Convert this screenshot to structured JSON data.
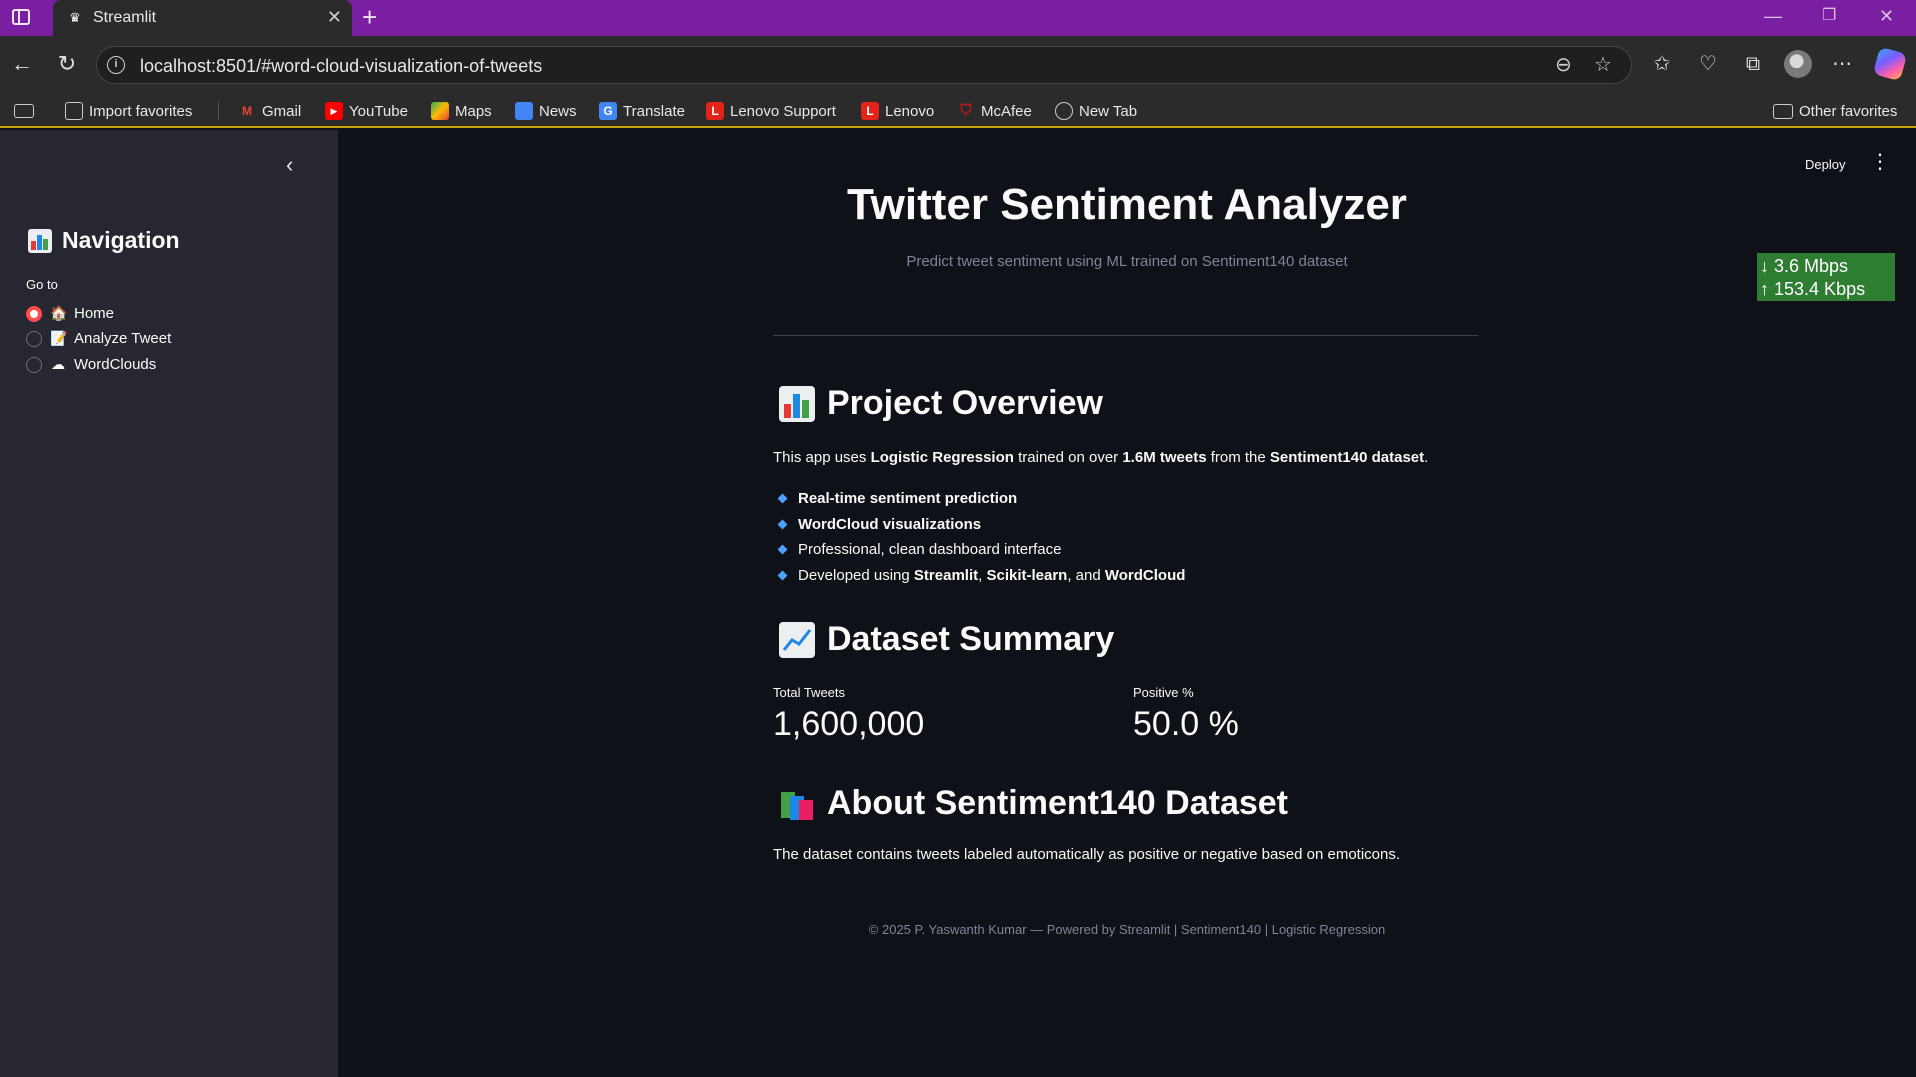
{
  "browser": {
    "tab_title": "Streamlit",
    "url": "localhost:8501/#word-cloud-visualization-of-tweets",
    "bookmarks": [
      {
        "label": "Import favorites",
        "icon": "import-icon"
      },
      {
        "label": "Gmail",
        "icon": "gmail-icon",
        "color": "#ea4335"
      },
      {
        "label": "YouTube",
        "icon": "youtube-icon",
        "color": "#ff0000"
      },
      {
        "label": "Maps",
        "icon": "maps-icon",
        "color": "#34a853"
      },
      {
        "label": "News",
        "icon": "news-icon",
        "color": "#4285f4"
      },
      {
        "label": "Translate",
        "icon": "translate-icon",
        "color": "#4285f4"
      },
      {
        "label": "Lenovo Support",
        "icon": "lenovo-icon",
        "color": "#e2231a"
      },
      {
        "label": "Lenovo",
        "icon": "lenovo-icon",
        "color": "#e2231a"
      },
      {
        "label": "McAfee",
        "icon": "mcafee-icon",
        "color": "#c01818"
      },
      {
        "label": "New Tab",
        "icon": "globe-icon"
      }
    ],
    "other_favorites": "Other favorites"
  },
  "sidebar": {
    "title": "Navigation",
    "goto_label": "Go to",
    "options": [
      {
        "label": "Home",
        "icon": "house-icon",
        "selected": true
      },
      {
        "label": "Analyze Tweet",
        "icon": "memo-icon",
        "selected": false
      },
      {
        "label": "WordClouds",
        "icon": "cloud-icon",
        "selected": false
      }
    ]
  },
  "header": {
    "deploy_label": "Deploy"
  },
  "netspeed": {
    "down": "3.6 Mbps",
    "up": "153.4 Kbps"
  },
  "main": {
    "title": "Twitter Sentiment Analyzer",
    "subtitle": "Predict tweet sentiment using ML trained on Sentiment140 dataset",
    "overview": {
      "heading": "Project Overview",
      "intro": {
        "p1": "This app uses ",
        "b1": "Logistic Regression",
        "p2": " trained on over ",
        "b2": "1.6M tweets",
        "p3": " from the ",
        "b3": "Sentiment140 dataset",
        "p4": "."
      },
      "bullets": {
        "b1": "Real-time sentiment prediction",
        "b2": "WordCloud visualizations",
        "b3": "Professional, clean dashboard interface",
        "b4_p1": "Developed using ",
        "b4_b1": "Streamlit",
        "b4_p2": ", ",
        "b4_b2": "Scikit-learn",
        "b4_p3": ", and ",
        "b4_b3": "WordCloud"
      }
    },
    "summary": {
      "heading": "Dataset Summary",
      "total_label": "Total Tweets",
      "total_value": "1,600,000",
      "positive_label": "Positive %",
      "positive_value": "50.0 %"
    },
    "about": {
      "heading": "About Sentiment140 Dataset",
      "text": "The dataset contains tweets labeled automatically as positive or negative based on emoticons."
    },
    "footer": "© 2025 P. Yaswanth Kumar — Powered by Streamlit | Sentiment140 | Logistic Regression"
  }
}
